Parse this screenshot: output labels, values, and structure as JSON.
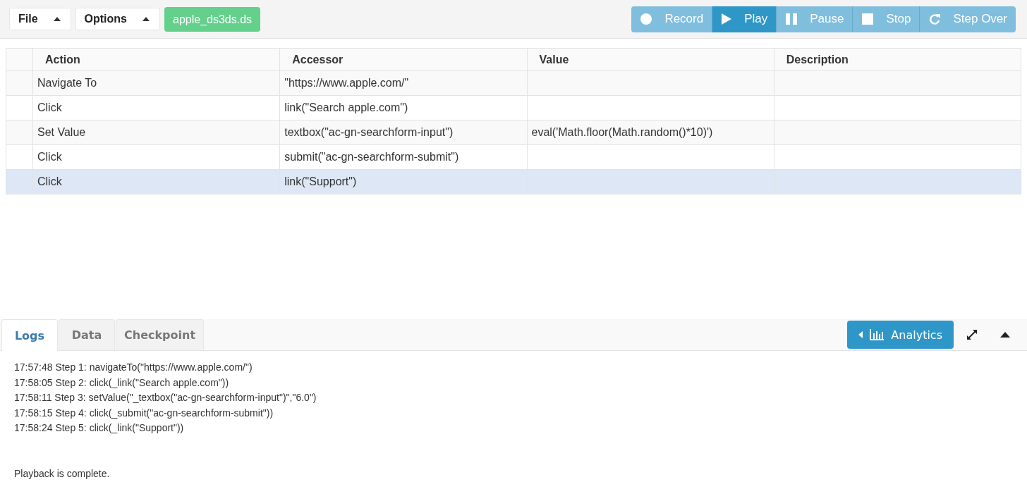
{
  "menus": [
    {
      "label": "File"
    },
    {
      "label": "Options"
    }
  ],
  "file_badge": "apple_ds3ds.ds",
  "transport": [
    {
      "kind": "record",
      "label": "Record",
      "selected": false
    },
    {
      "kind": "play",
      "label": "Play",
      "selected": true
    },
    {
      "kind": "pause",
      "label": "Pause",
      "selected": false
    },
    {
      "kind": "stop",
      "label": "Stop",
      "selected": false
    },
    {
      "kind": "stepover",
      "label": "Step Over",
      "selected": false
    }
  ],
  "table": {
    "columns": [
      "Action",
      "Accessor",
      "Value",
      "Description"
    ],
    "rows": [
      {
        "cells": [
          "Navigate To",
          "\"https://www.apple.com/\"",
          "",
          ""
        ],
        "selected": false
      },
      {
        "cells": [
          "Click",
          "link(\"Search apple.com\")",
          "",
          ""
        ],
        "selected": false
      },
      {
        "cells": [
          "Set Value",
          "textbox(\"ac-gn-searchform-input\")",
          "eval('Math.floor(Math.random()*10)')",
          ""
        ],
        "selected": false
      },
      {
        "cells": [
          "Click",
          "submit(\"ac-gn-searchform-submit\")",
          "",
          ""
        ],
        "selected": false
      },
      {
        "cells": [
          "Click",
          "link(\"Support\")",
          "",
          ""
        ],
        "selected": true
      }
    ]
  },
  "tabs": [
    {
      "label": "Logs",
      "selected": true
    },
    {
      "label": "Data",
      "selected": false
    },
    {
      "label": "Checkpoint",
      "selected": false
    }
  ],
  "analytics_button": "Analytics",
  "log_lines": [
    "17:57:48 Step 1: navigateTo(\"https://www.apple.com/\")",
    "17:58:05 Step 2: click(_link(\"Search apple.com\"))",
    "17:58:11 Step 3: setValue(\"_textbox(\"ac-gn-searchform-input\")\",\"6.0\")",
    "17:58:15 Step 4: click(_submit(\"ac-gn-searchform-submit\"))",
    "17:58:24 Step 5: click(_link(\"Support\"))"
  ],
  "status_message": "Playback is complete."
}
